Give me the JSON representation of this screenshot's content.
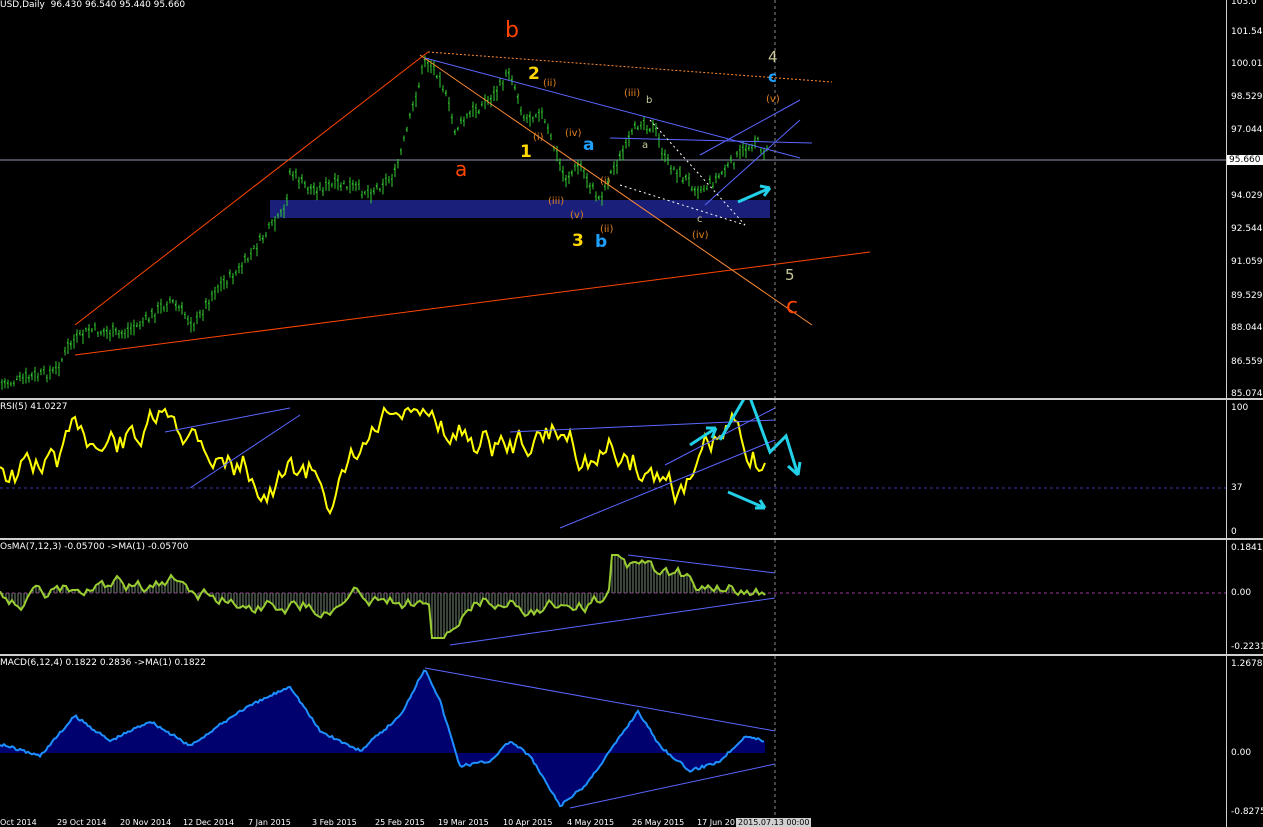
{
  "header": {
    "symbol": "USD,Daily",
    "ohlc": "96.430 96.540 95.440 95.660"
  },
  "price_scale": {
    "ticks": [
      "103.0",
      "101.544",
      "100.014",
      "98.529",
      "97.044",
      "95.660",
      "94.029",
      "92.544",
      "91.059",
      "89.529",
      "88.044",
      "86.559",
      "85.074"
    ],
    "current": "95.660"
  },
  "rsi": {
    "label": "RSI(5) 41.0227",
    "ticks": [
      "100",
      "37",
      "0"
    ]
  },
  "osma": {
    "label": "OsMA(7,12,3) -0.05700  ->MA(1) -0.05700",
    "ticks": [
      "0.18413",
      "0.00",
      "-0.22312"
    ]
  },
  "macd": {
    "label": "MACD(6,12,4) 0.1822 0.2836  ->MA(1) 0.1822",
    "ticks": [
      "1.2678",
      "0.00",
      "-0.8275"
    ]
  },
  "dates": [
    "Oct 2014",
    "29 Oct 2014",
    "20 Nov 2014",
    "12 Dec 2014",
    "7 Jan 2015",
    "3 Feb 2015",
    "25 Feb 2015",
    "19 Mar 2015",
    "10 Apr 2015",
    "4 May 2015",
    "26 May 2015",
    "17 Jun 2015",
    "2015.07.13 00:00"
  ],
  "wave_labels": {
    "b_top": "b",
    "a_left": "a",
    "c_right": "c",
    "five": "5",
    "four": "4",
    "c_blue_top": "c",
    "two": "2",
    "one": "1",
    "three": "3",
    "a_blue": "a",
    "b_blue": "b",
    "ii": "(ii)",
    "i": "(i)",
    "iv": "(iv)",
    "iii_low": "(iii)",
    "v_low": "(v)",
    "ii_low": "(ii)",
    "i_mid": "(i)",
    "iii_top": "(iii)",
    "b_small": "b",
    "a_small": "a",
    "c_small": "c",
    "iv_low": "(iv)",
    "v_top": "(v)"
  },
  "colors": {
    "price": "#32cd32",
    "rsi": "#ffff00",
    "osma": "#9acd32",
    "macd": "#1e90ff",
    "wave_red": "#ff4500",
    "wave_yellow": "#ffd700",
    "wave_cyan": "#1ea0ff",
    "wave_orange": "#e08020",
    "trend_blue": "#5a66ff",
    "zone": "#1a1f7a",
    "arrow": "#22d0e8"
  }
}
